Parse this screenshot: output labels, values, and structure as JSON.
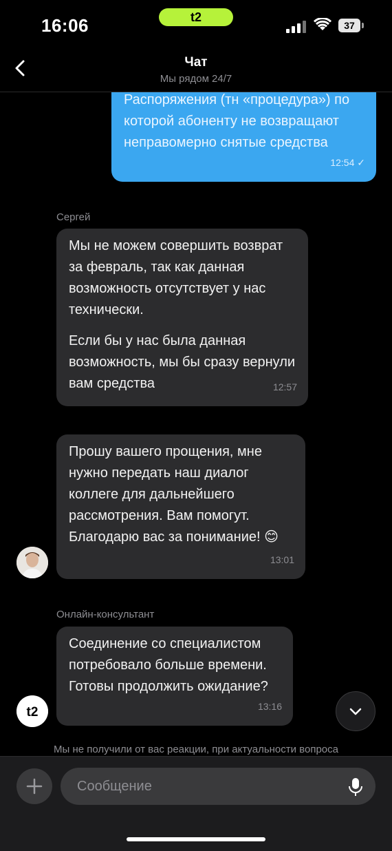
{
  "status_bar": {
    "time": "16:06",
    "carrier_logo": "t2",
    "battery": "37"
  },
  "header": {
    "title": "Чат",
    "subtitle": "Мы рядом 24/7"
  },
  "messages": [
    {
      "direction": "outgoing",
      "text": "Распоряжения (тн «процедура») по которой абоненту не возвращают неправомерно снятые средства",
      "time": "12:54 ✓"
    },
    {
      "direction": "incoming",
      "sender": "Сергей",
      "paragraphs": [
        "Мы не можем совершить возврат за февраль, так как данная возможность отсутствует у нас технически.",
        "Если бы у нас была данная возможность, мы бы сразу вернули вам средства"
      ],
      "time": "12:57"
    },
    {
      "direction": "incoming",
      "text": "Прошу вашего прощения, мне нужно передать наш диалог коллеге для дальнейшего рассмотрения. Вам помогут. Благодарю вас за понимание! 😊",
      "time": "13:01",
      "avatar": "person-avatar"
    },
    {
      "direction": "incoming",
      "sender": "Онлайн-консультант",
      "text": "Соединение со специалистом потребовало больше времени. Готовы продолжить ожидание?",
      "time": "13:16",
      "avatar": "t2-logo-avatar"
    }
  ],
  "notice": "Мы не получили от вас реакции, при актуальности вопроса",
  "input": {
    "placeholder": "Сообщение"
  },
  "colors": {
    "outgoing": "#3ba7f0",
    "incoming": "#2c2c2e",
    "brand": "#b6f23a"
  }
}
